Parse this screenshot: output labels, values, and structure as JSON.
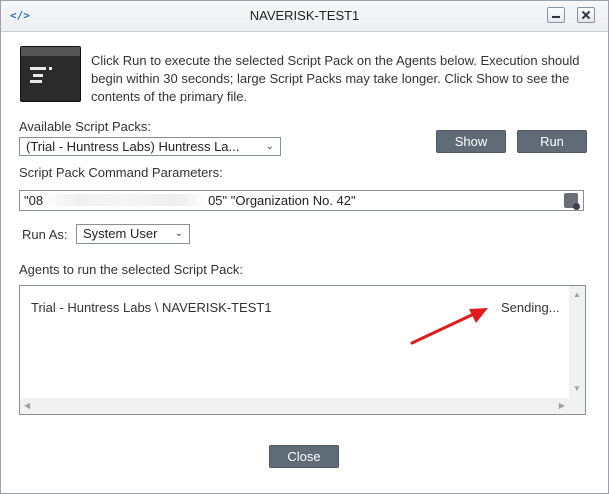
{
  "window": {
    "title": "NAVERISK-TEST1"
  },
  "description": "Click Run to execute the selected Script Pack on the Agents below. Execution should begin within 30 seconds; large Script Packs may take longer. Click Show to see the contents of the primary file.",
  "script_packs": {
    "label": "Available Script Packs:",
    "selected": "(Trial - Huntress Labs) Huntress La..."
  },
  "buttons": {
    "show": "Show",
    "run": "Run",
    "close": "Close"
  },
  "parameters": {
    "label": "Script Pack Command Parameters:",
    "value_prefix": "\"08",
    "value_suffix": "05\" \"Organization No. 42\""
  },
  "run_as": {
    "label": "Run As:",
    "selected": "System User"
  },
  "agents": {
    "label": "Agents to run the selected Script Pack:",
    "rows": [
      {
        "name": "Trial - Huntress Labs \\ NAVERISK-TEST1",
        "status": "Sending..."
      }
    ]
  },
  "colors": {
    "button_bg": "#5f6b76",
    "annotation_arrow": "#e11b1b"
  }
}
